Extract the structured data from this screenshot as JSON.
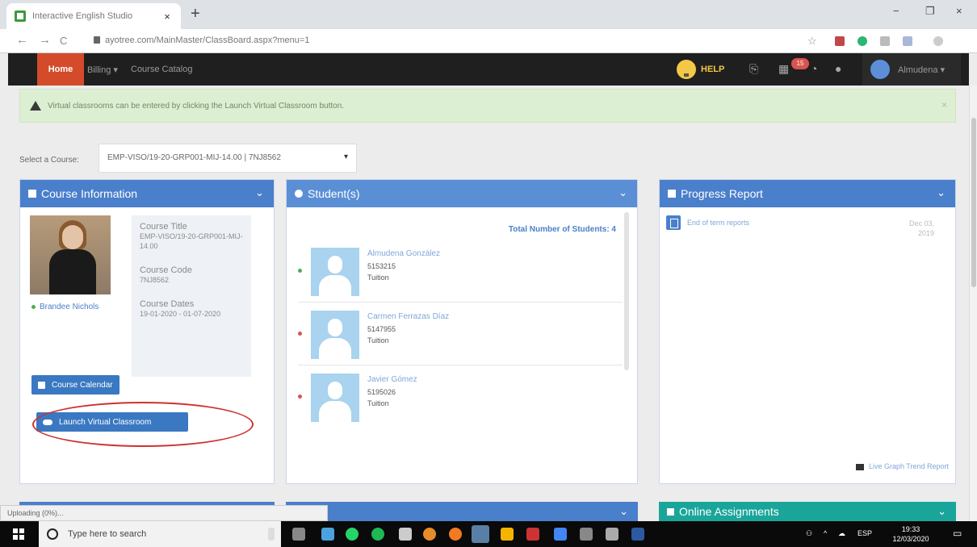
{
  "browser": {
    "tab_title": "Interactive English Studio",
    "tab_close": "×",
    "new_tab": "+",
    "url": "ayotree.com/MainMaster/ClassBoard.aspx?menu=1",
    "nav_back": "←",
    "nav_forward": "→",
    "nav_reload": "C",
    "win_minimize": "−",
    "win_restore": "❐",
    "win_close": "×",
    "star": "☆"
  },
  "navbar": {
    "home": "Home",
    "billing": "Billing ▾",
    "catalog": "Course Catalog",
    "help": "HELP",
    "badge": "15",
    "user": "Almudena ▾"
  },
  "alert": {
    "text": "Virtual classrooms can be entered by clicking the Launch Virtual Classroom button.",
    "close": "×"
  },
  "course_select": {
    "label": "Select a Course:",
    "value": "EMP-VISO/19-20-GRP001-MIJ-14.00 | 7NJ8562",
    "caret": "▾"
  },
  "course_info": {
    "header": "Course Information",
    "chevron": "⌄",
    "teacher": "Brandee Nichols",
    "title_label": "Course Title",
    "title_value": "EMP-VISO/19-20-GRP001-MIJ-14.00",
    "code_label": "Course Code",
    "code_value": "7NJ8562",
    "dates_label": "Course Dates",
    "dates_value": "19-01-2020 - 01-07-2020",
    "calendar_btn": "Course Calendar",
    "launch_btn": "Launch Virtual Classroom"
  },
  "students": {
    "header": "Student(s)",
    "chevron": "⌄",
    "total": "Total Number of Students: 4",
    "list": [
      {
        "name": "Almudena González",
        "id": "5153215",
        "role": "Tuition",
        "status": "green"
      },
      {
        "name": "Carmen Ferrazas Díaz",
        "id": "5147955",
        "role": "Tuition",
        "status": "red"
      },
      {
        "name": "Javier Gómez",
        "id": "5195026",
        "role": "Tuition",
        "status": "red"
      }
    ]
  },
  "progress": {
    "header": "Progress Report",
    "chevron": "⌄",
    "report": "End of term reports",
    "date": "Dec 03, 2019",
    "trend": "Live Graph Trend Report"
  },
  "assignments": {
    "header": "Online Assignments",
    "chevron": "⌄"
  },
  "status_text": "Uploading (0%)...",
  "taskbar": {
    "search_placeholder": "Type here to search",
    "lang": "ESP",
    "time": "19:33",
    "date": "12/03/2020"
  }
}
